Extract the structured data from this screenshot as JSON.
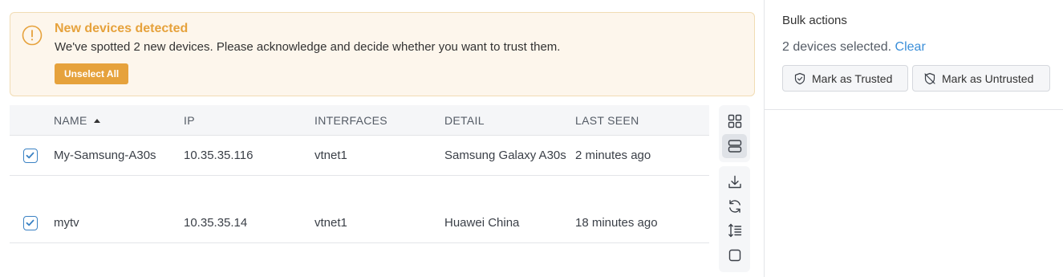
{
  "alert": {
    "title": "New devices detected",
    "message": "We've spotted 2 new devices. Please acknowledge and decide whether you want to trust them.",
    "unselect_label": "Unselect All",
    "accent_color": "#e6a23c"
  },
  "table": {
    "columns": {
      "name": "NAME",
      "ip": "IP",
      "interfaces": "INTERFACES",
      "detail": "DETAIL",
      "last_seen": "LAST SEEN"
    },
    "sort": {
      "column": "name",
      "direction": "ascending"
    },
    "rows": [
      {
        "selected": true,
        "name": "My-Samsung-A30s",
        "ip": "10.35.35.116",
        "interfaces": "vtnet1",
        "detail": "Samsung Galaxy A30s",
        "last_seen": "2 minutes ago"
      },
      {
        "selected": true,
        "name": "mytv",
        "ip": "10.35.35.14",
        "interfaces": "vtnet1",
        "detail": "Huawei China",
        "last_seen": "18 minutes ago"
      }
    ]
  },
  "toolbar": {
    "view_buttons": [
      "grid-view-icon",
      "list-view-icon"
    ],
    "active_view": "list-view-icon",
    "action_buttons": [
      "download-icon",
      "refresh-icon",
      "row-density-icon",
      "checkbox-square-icon"
    ]
  },
  "bulk": {
    "title": "Bulk actions",
    "selected_text": "2 devices selected.",
    "clear_label": "Clear",
    "trusted_label": "Mark as Trusted",
    "untrusted_label": "Mark as Untrusted",
    "link_color": "#3b8fd9"
  }
}
